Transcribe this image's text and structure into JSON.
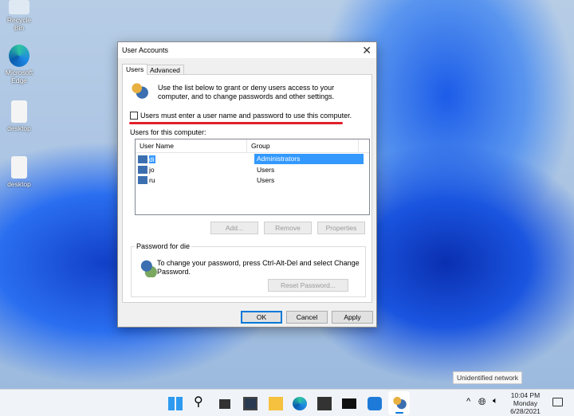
{
  "desktop": {
    "icons": [
      {
        "label": "Recycle Bin"
      },
      {
        "label": "Microsoft Edge"
      },
      {
        "label": "desktop"
      },
      {
        "label": "desktop"
      }
    ]
  },
  "dialog": {
    "title": "User Accounts",
    "tabs": [
      "Users",
      "Advanced"
    ],
    "intro": "Use the list below to grant or deny users access to your computer, and to change passwords and other settings.",
    "checkbox_label": "Users must enter a user name and password to use this computer.",
    "checkbox_checked": false,
    "list_label": "Users for this computer:",
    "columns": [
      "User Name",
      "Group"
    ],
    "rows": [
      {
        "name": "di",
        "group": "Administrators"
      },
      {
        "name": "jo",
        "group": "Users"
      },
      {
        "name": "ru",
        "group": "Users"
      }
    ],
    "buttons": {
      "add": "Add...",
      "remove": "Remove",
      "properties": "Properties",
      "reset": "Reset Password...",
      "ok": "OK",
      "cancel": "Cancel",
      "apply": "Apply"
    },
    "password_group": "Password for die",
    "password_text": "To change your password, press Ctrl-Alt-Del and select Change Password."
  },
  "tooltip": "Unidentified network",
  "taskbar": {
    "time": "10:04 PM",
    "day": "Monday",
    "date": "6/28/2021"
  },
  "colors": {
    "accent": "#0078d7",
    "highlight": "#3399ff",
    "annotation": "#e0202a"
  }
}
